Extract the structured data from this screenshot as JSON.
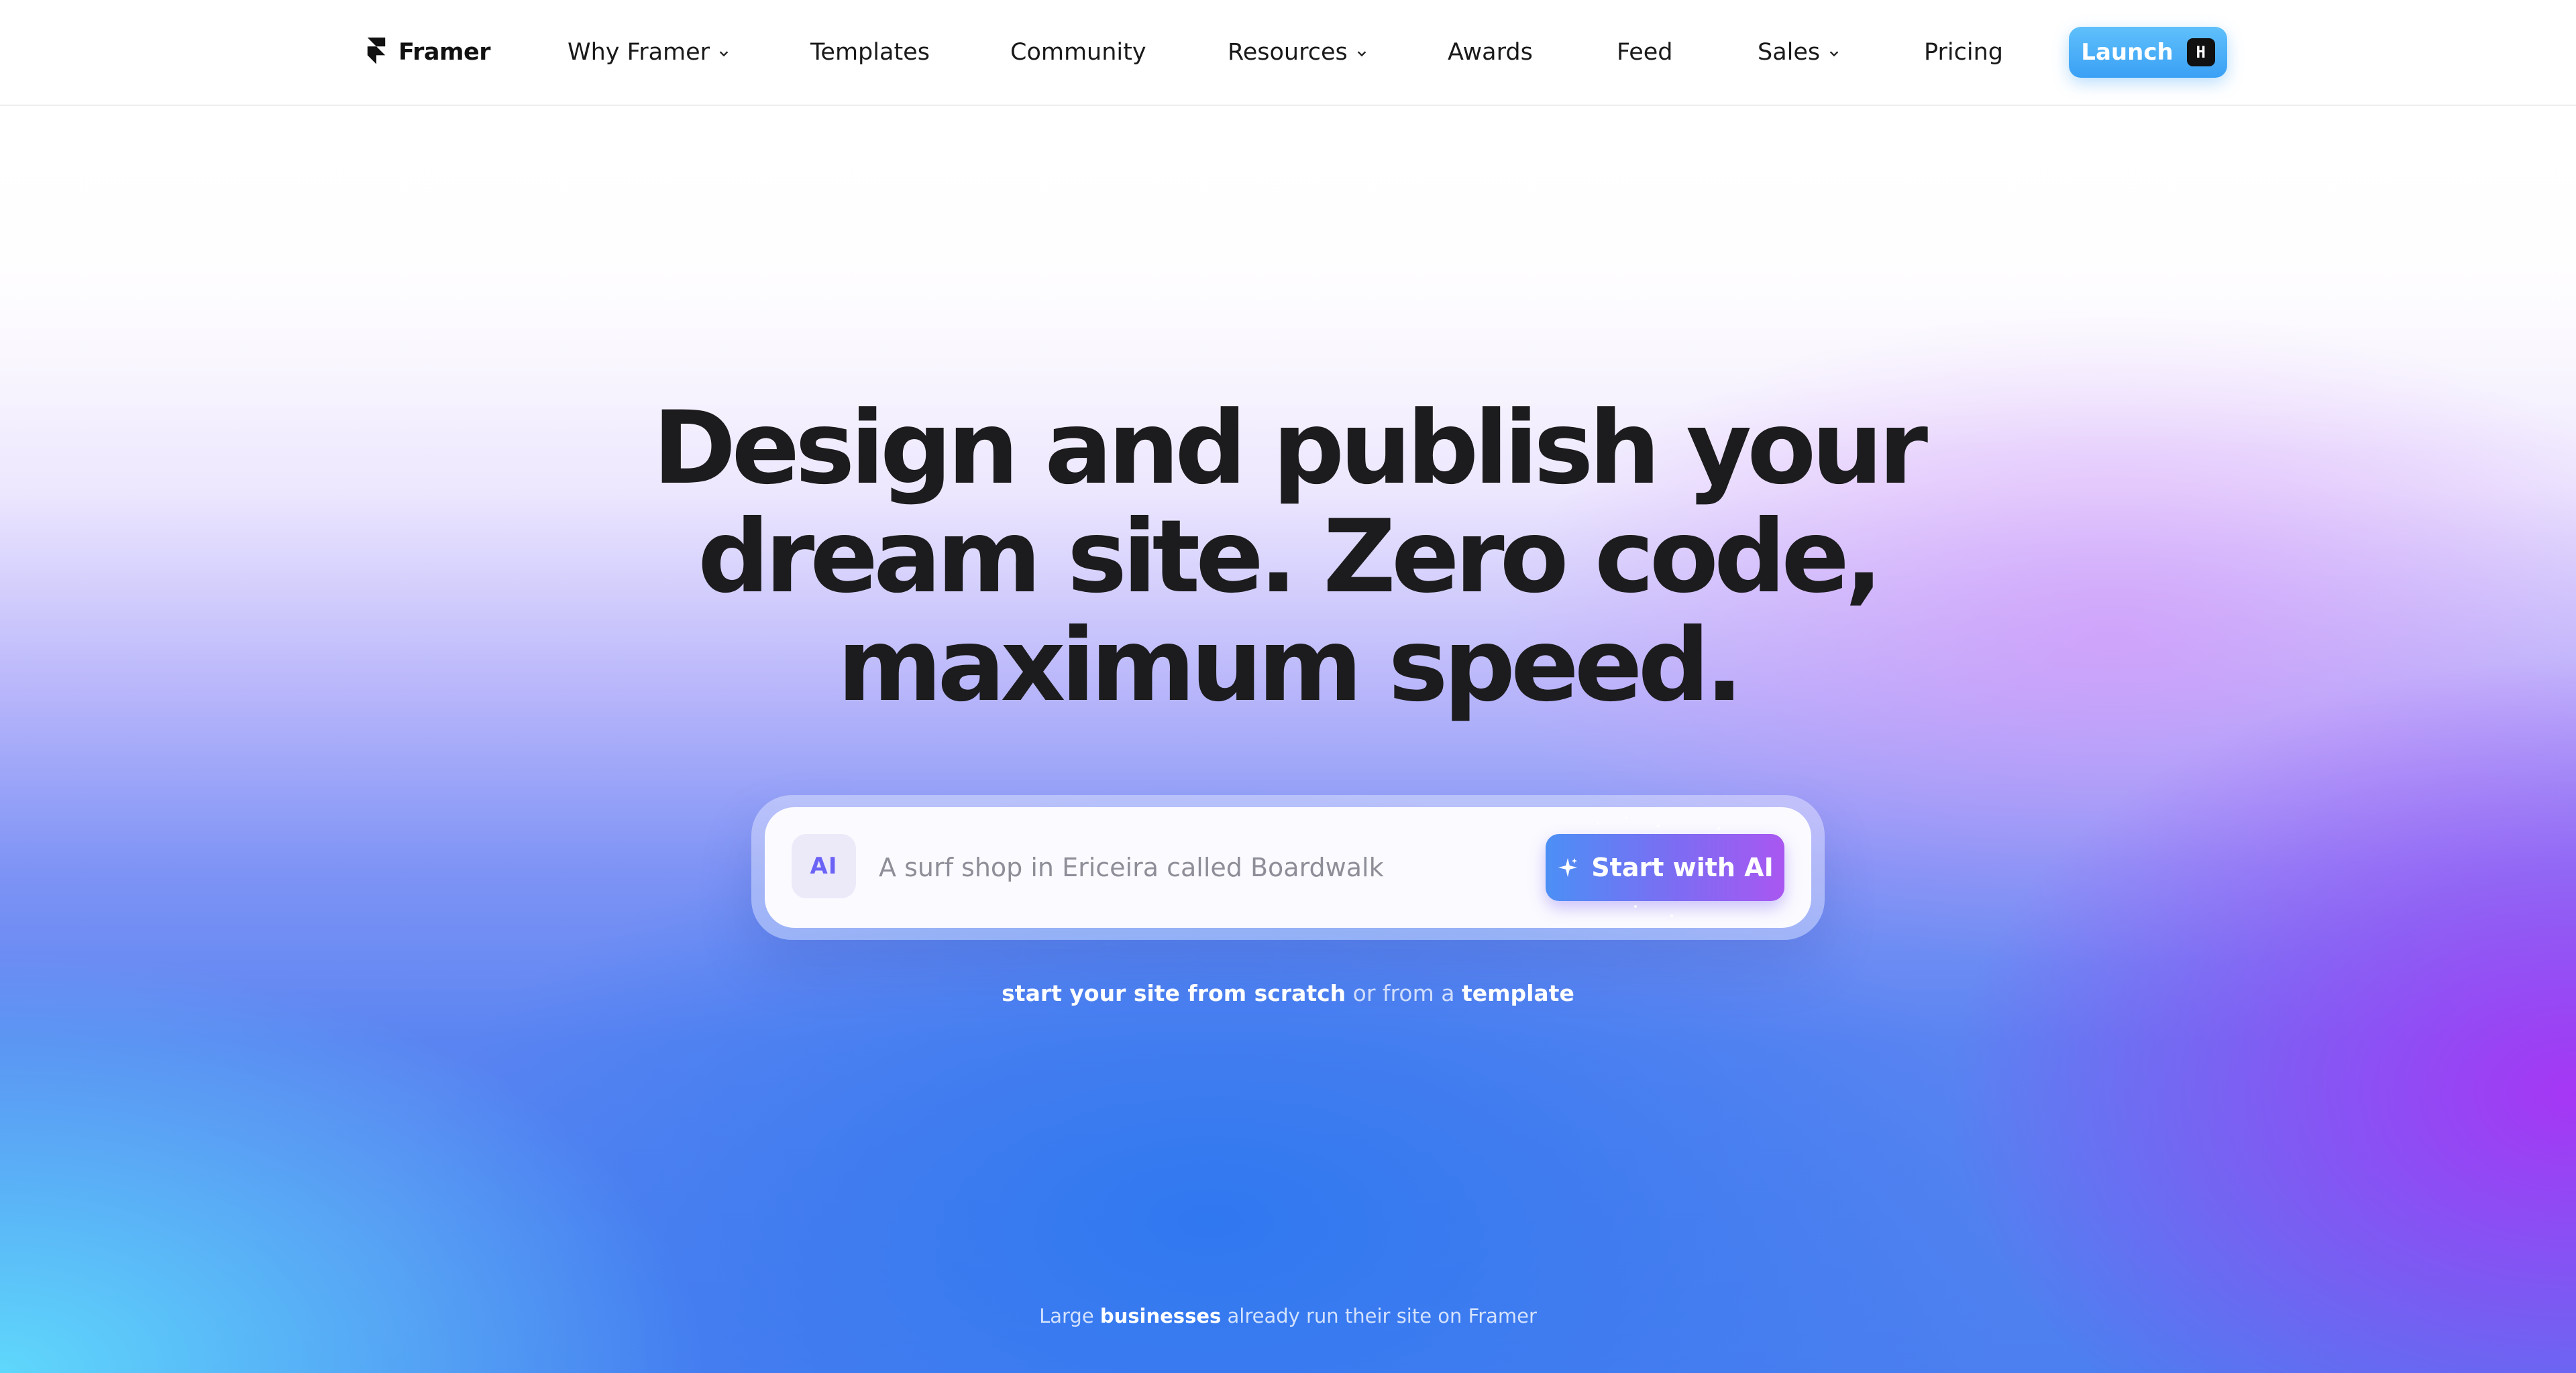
{
  "nav": {
    "logo_label": "Framer",
    "items": [
      {
        "label": "Why Framer",
        "has_dropdown": true
      },
      {
        "label": "Templates",
        "has_dropdown": false
      },
      {
        "label": "Community",
        "has_dropdown": false
      },
      {
        "label": "Resources",
        "has_dropdown": true
      },
      {
        "label": "Awards",
        "has_dropdown": false
      },
      {
        "label": "Feed",
        "has_dropdown": false
      },
      {
        "label": "Sales",
        "has_dropdown": true
      },
      {
        "label": "Pricing",
        "has_dropdown": false
      }
    ],
    "launch_label": "Launch",
    "launch_shortcut": "H"
  },
  "hero": {
    "headline_lines": [
      "Design and publish your",
      "dream site. Zero code,",
      "maximum speed."
    ]
  },
  "prompt": {
    "badge": "AI",
    "placeholder": "A surf shop in Ericeira called Boardwalk",
    "value": "",
    "button_label": "Start with AI"
  },
  "subline": {
    "scratch_link": "start your site from scratch",
    "connector": "or from a",
    "template_link": "template"
  },
  "footnote": {
    "prefix": "Large",
    "emphasis": "businesses",
    "suffix": "already run their site on Framer"
  },
  "colors": {
    "launch_button": "#3aa0f5",
    "start_button_from": "#4c8ff5",
    "start_button_to": "#a957f1",
    "headline": "#1c1c1e",
    "ai_badge": "#6b63f6"
  },
  "icons": {
    "logo": "framer-logo-icon",
    "dropdown": "chevron-down-icon",
    "start_button": "sparkle-icon"
  }
}
